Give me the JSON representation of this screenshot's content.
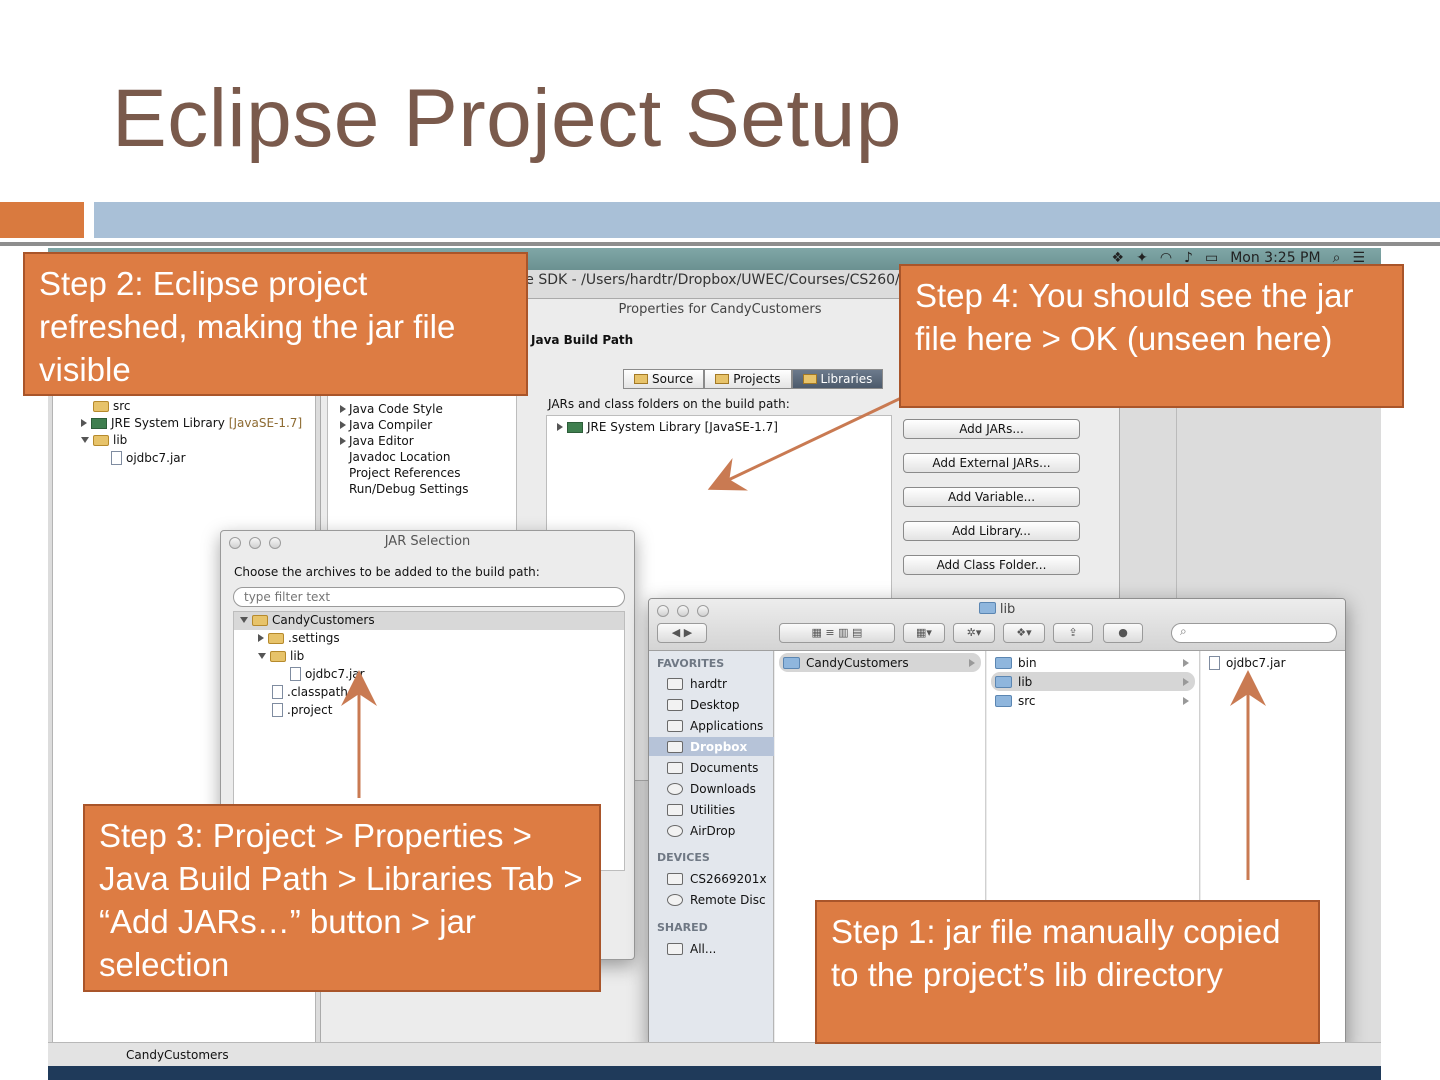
{
  "slide": {
    "title": "Eclipse Project Setup",
    "accent_colors": {
      "title": "#7a5a4c",
      "bar_orange": "#d97a3f",
      "bar_blue": "#a9c0d7",
      "callout": "#dd7c43"
    }
  },
  "menubar": {
    "clock": "Mon 3:25 PM",
    "icons": [
      "dropbox-icon",
      "twitter-icon",
      "wifi-icon",
      "volume-icon",
      "battery-icon",
      "spotlight-icon",
      "list-icon"
    ]
  },
  "eclipse": {
    "window_title": "se SDK - /Users/hardtr/Dropbox/UWEC/Courses/CS260/",
    "explorer": {
      "items": [
        "src",
        "JRE System Library",
        "[JavaSE-1.7]",
        "lib",
        "ojdbc7.jar"
      ]
    },
    "status_text": "CandyCustomers"
  },
  "properties": {
    "title": "Properties for CandyCustomers",
    "heading": "Java Build Path",
    "left_items": [
      "Java Code Style",
      "Java Compiler",
      "Java Editor",
      "Javadoc Location",
      "Project References",
      "Run/Debug Settings"
    ],
    "tabs": [
      "Source",
      "Projects",
      "Libraries"
    ],
    "active_tab": "Libraries",
    "build_label": "JARs and class folders on the build path:",
    "build_entries": [
      "JRE System Library [JavaSE-1.7]"
    ],
    "buttons": [
      "Add JARs...",
      "Add External JARs...",
      "Add Variable...",
      "Add Library...",
      "Add Class Folder..."
    ]
  },
  "jar_selection": {
    "title": "JAR Selection",
    "prompt": "Choose the archives to be added to the build path:",
    "filter_placeholder": "type filter text",
    "tree": [
      "CandyCustomers",
      ".settings",
      "lib",
      "ojdbc7.jar",
      ".classpath",
      ".project"
    ]
  },
  "finder": {
    "title": "lib",
    "favorites_label": "FAVORITES",
    "favorites": [
      "hardtr",
      "Desktop",
      "Applications",
      "Dropbox",
      "Documents",
      "Downloads",
      "Utilities",
      "AirDrop"
    ],
    "selected_favorite": "Dropbox",
    "devices_label": "DEVICES",
    "devices": [
      "CS2669201x",
      "Remote Disc"
    ],
    "shared_label": "SHARED",
    "shared": [
      "All..."
    ],
    "col1": [
      "CandyCustomers"
    ],
    "col2": [
      "bin",
      "lib",
      "src"
    ],
    "col3": [
      "ojdbc7.jar"
    ]
  },
  "callouts": {
    "step1": "Step 1: jar file manually copied to the project’s lib directory",
    "step2": "Step 2: Eclipse project refreshed, making the jar file visible",
    "step3": "Step 3: Project > Properties > Java Build Path > Libraries Tab > “Add JARs…” button > jar selection",
    "step4": "Step 4: You should see the jar file here > OK (unseen here)"
  }
}
